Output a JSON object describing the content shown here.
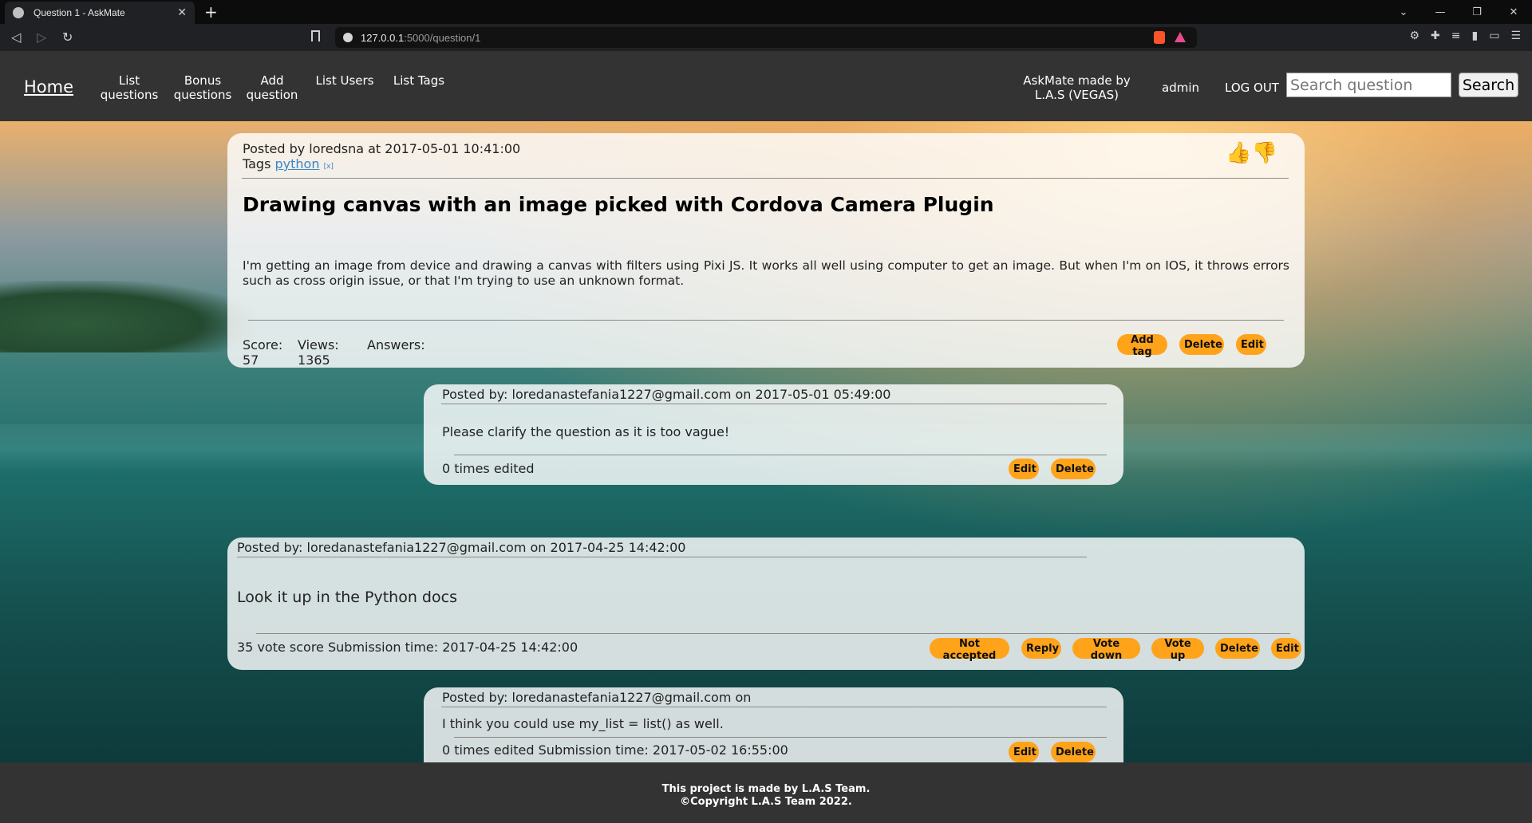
{
  "browser": {
    "tab_title": "Question 1 - AskMate",
    "url_host": "127.0.0.1",
    "url_path": ":5000/question/1"
  },
  "navbar": {
    "home": "Home",
    "links": [
      {
        "label": "List questions"
      },
      {
        "label": "Bonus questions"
      },
      {
        "label": "Add question"
      },
      {
        "label": "List Users"
      },
      {
        "label": "List Tags"
      }
    ],
    "made_by": "AskMate made by L.A.S (VEGAS)",
    "user": "admin",
    "logout": "LOG OUT",
    "search_placeholder": "Search question",
    "search_button": "Search"
  },
  "question": {
    "posted_by": "Posted by loredsna at 2017-05-01 10:41:00",
    "tags_label": "Tags",
    "tag": "python",
    "tag_remove": "[x]",
    "title": "Drawing canvas with an image picked with Cordova Camera Plugin",
    "body": "I'm getting an image from device and drawing a canvas with filters using Pixi JS. It works all well using computer to get an image. But when I'm on IOS, it throws errors such as cross origin issue, or that I'm trying to use an unknown format.",
    "score_label": "Score:",
    "score": "57",
    "views_label": "Views:",
    "views": "1365",
    "answers_label": "Answers:",
    "buttons": {
      "add_tag": "Add tag",
      "delete": "Delete",
      "edit": "Edit"
    }
  },
  "question_comment": {
    "posted_by": "Posted by: loredanastefania1227@gmail.com on 2017-05-01 05:49:00",
    "text": "Please clarify the question as it is too vague!",
    "edited": "0 times edited",
    "buttons": {
      "edit": "Edit",
      "delete": "Delete"
    }
  },
  "answer": {
    "posted_by": "Posted by: loredanastefania1227@gmail.com on 2017-04-25 14:42:00",
    "text": "Look it up in the Python docs",
    "footer": "35 vote score Submission time: 2017-04-25 14:42:00",
    "buttons": {
      "not_accepted": "Not accepted",
      "reply": "Reply",
      "vote_down": "Vote down",
      "vote_up": "Vote up",
      "delete": "Delete",
      "edit": "Edit"
    }
  },
  "answer_comment": {
    "posted_by": "Posted by: loredanastefania1227@gmail.com on",
    "text": "I think you could use my_list = list() as well.",
    "edited": "0 times edited Submission time: 2017-05-02 16:55:00",
    "buttons": {
      "edit": "Edit",
      "delete": "Delete"
    }
  },
  "footer": {
    "line1": "This project is made by L.A.S Team.",
    "line2": "©Copyright L.A.S Team 2022."
  },
  "colors": {
    "accent": "#ffa31a",
    "navbar": "#333333",
    "link": "#3a86c8"
  },
  "icons": [
    "thumbs-up-icon",
    "thumbs-down-icon",
    "search-icon",
    "back-icon",
    "forward-icon",
    "reload-icon",
    "bookmark-icon",
    "info-icon"
  ]
}
